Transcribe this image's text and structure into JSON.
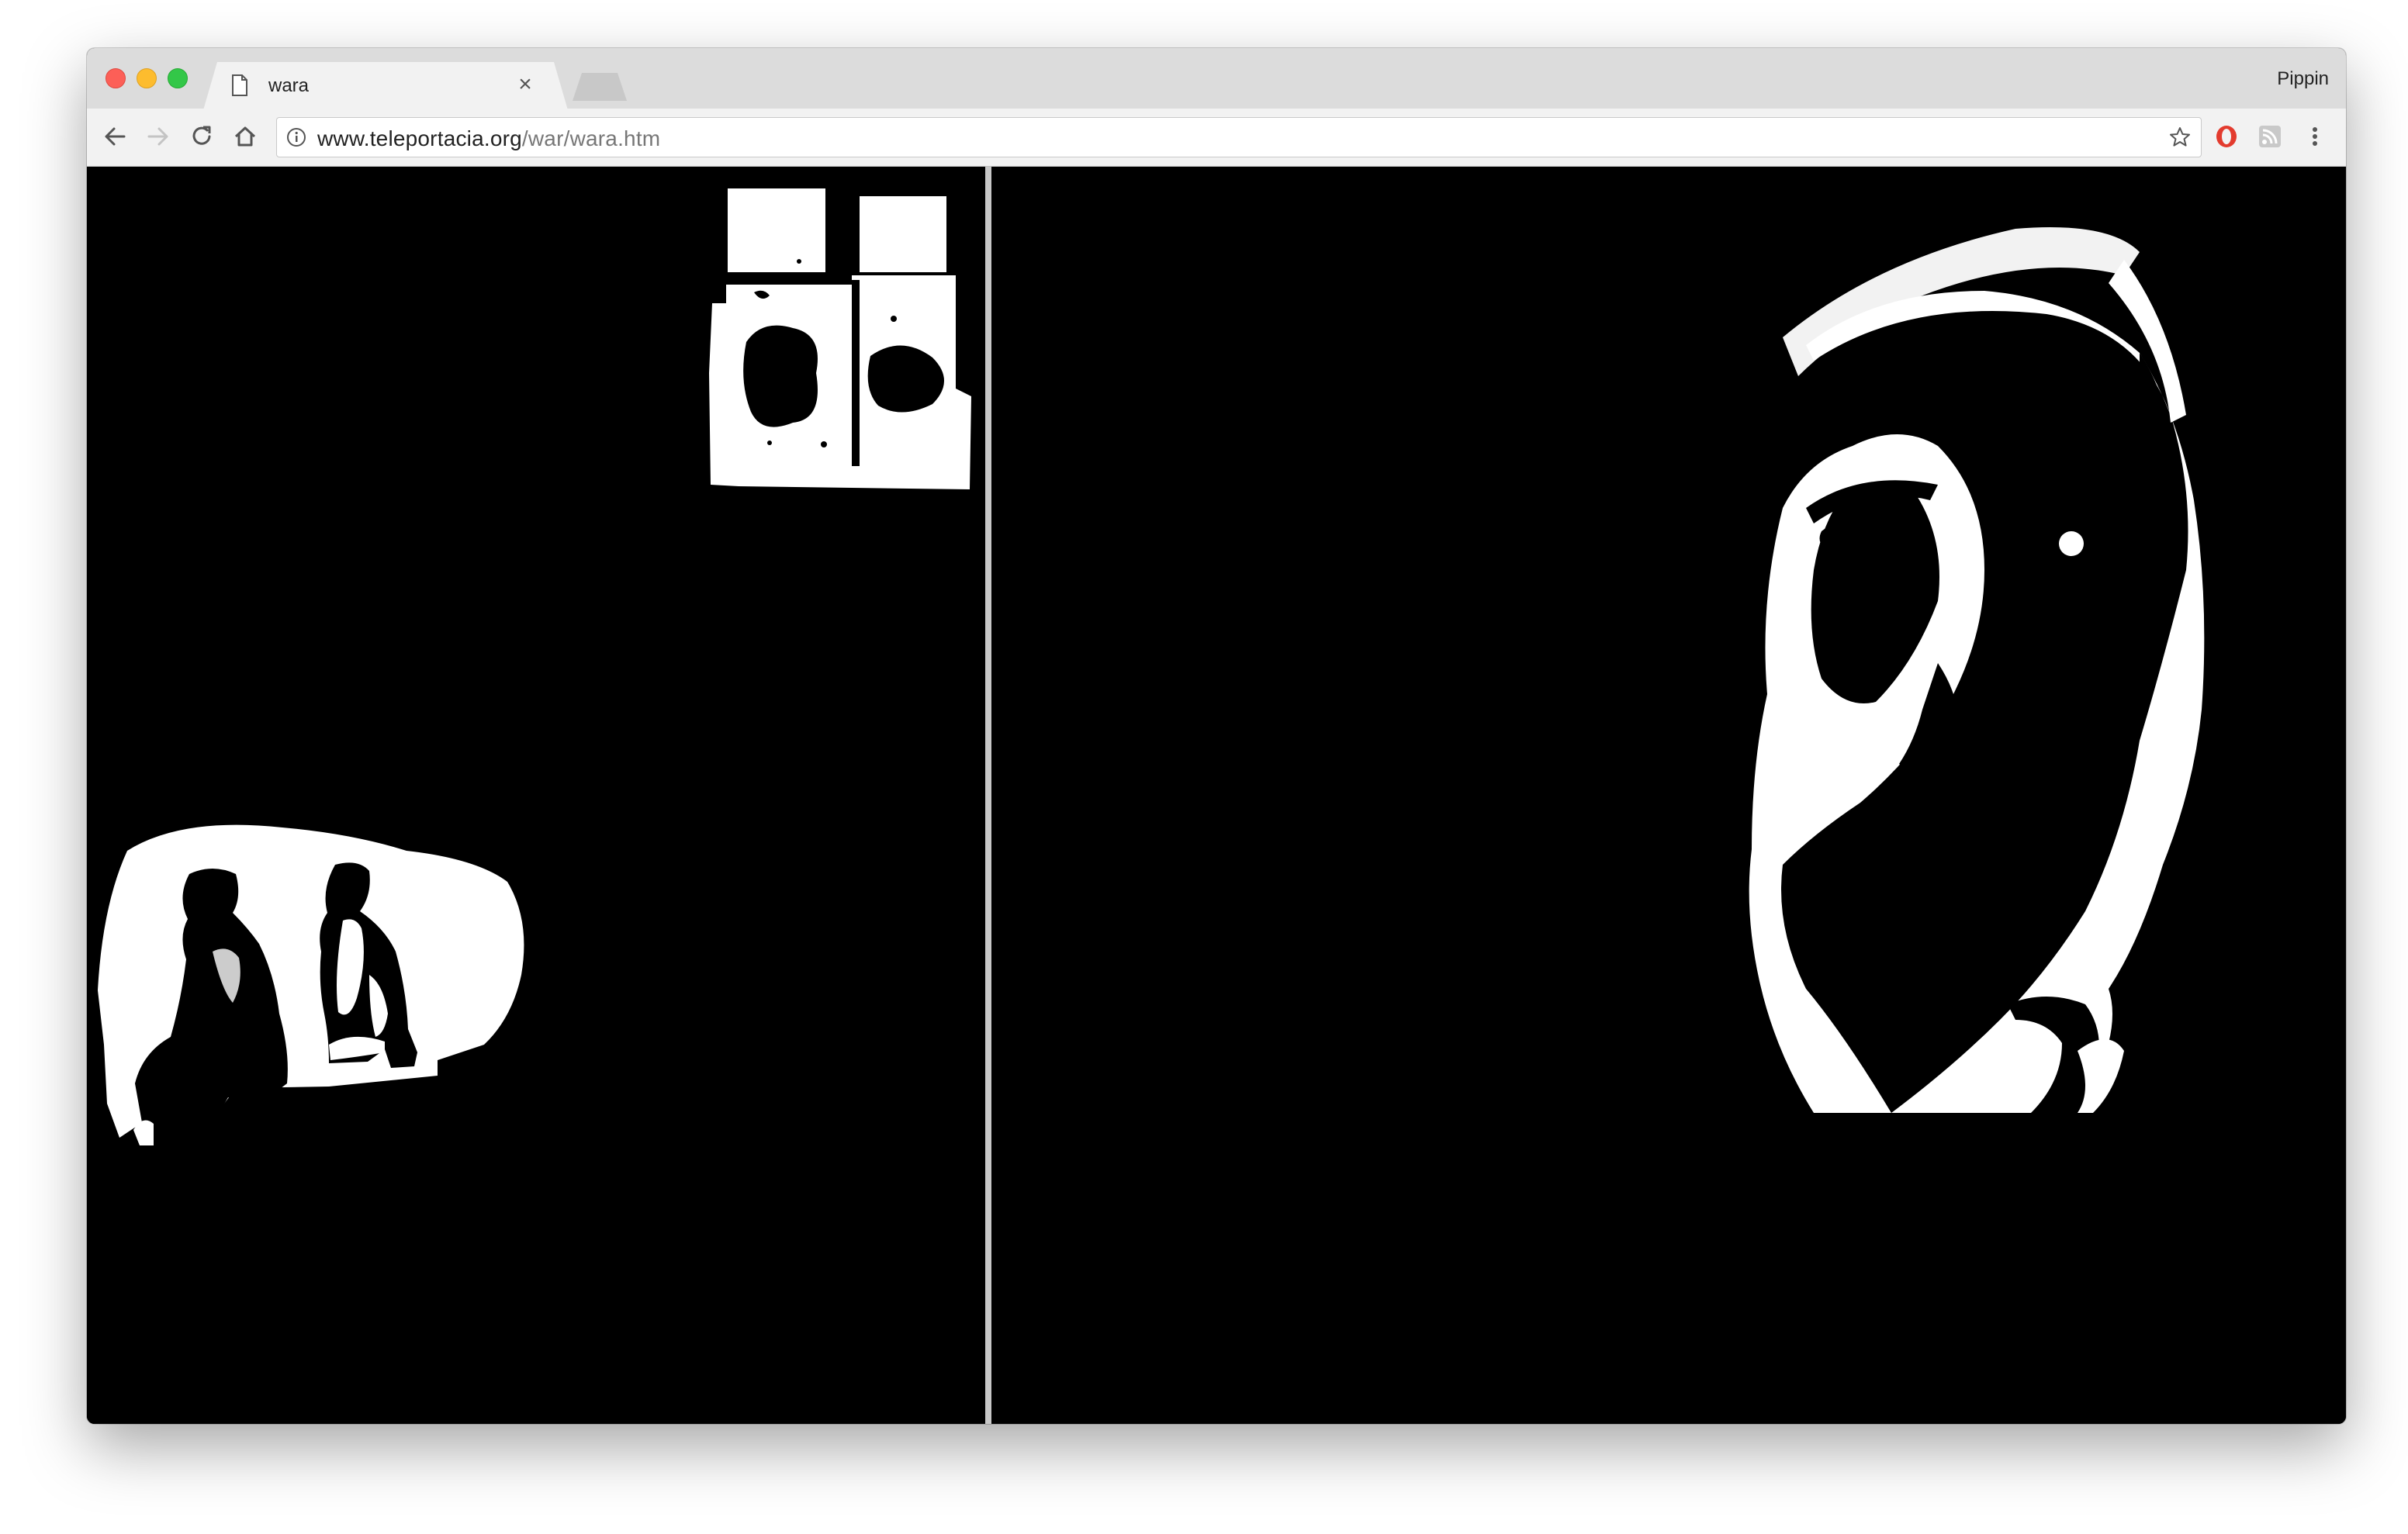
{
  "browser": {
    "tab": {
      "title": "wara",
      "icon": "page-icon",
      "close_glyph": "×"
    },
    "profile_name": "Pippin",
    "address": {
      "host": "www.teleportacia.org",
      "path": "/war/wara.htm"
    },
    "toolbar_icons": [
      "back-arrow-icon",
      "forward-arrow-icon",
      "reload-icon",
      "home-icon"
    ],
    "extensions": [
      "opera-icon",
      "rss-icon",
      "menu-dots-icon"
    ]
  },
  "page": {
    "frames": [
      {
        "name": "left-frame",
        "content": [
          "window-image",
          "two-figures-image"
        ]
      },
      {
        "name": "right-frame",
        "content": [
          "face-portrait-image"
        ]
      }
    ],
    "colors": {
      "background": "#000000",
      "foreground": "#ffffff",
      "frame_border": "#c7c7c7"
    }
  }
}
